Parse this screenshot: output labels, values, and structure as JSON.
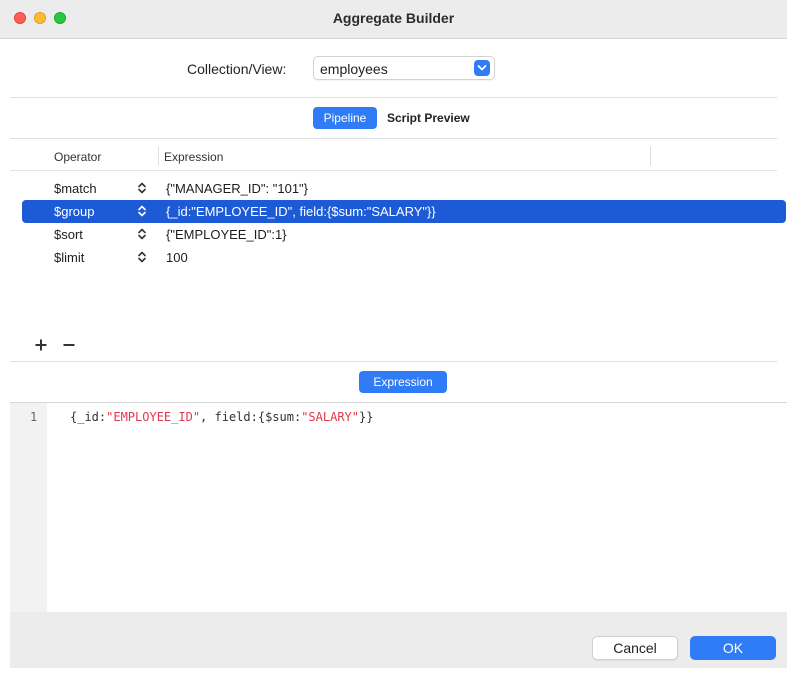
{
  "window": {
    "title": "Aggregate Builder"
  },
  "collection": {
    "label": "Collection/View:",
    "value": "employees"
  },
  "tabs": {
    "pipeline": "Pipeline",
    "script_preview": "Script Preview"
  },
  "table": {
    "columns": {
      "operator": "Operator",
      "expression": "Expression"
    },
    "rows": [
      {
        "operator": "$match",
        "expression": "{\"MANAGER_ID\": \"101\"}",
        "selected": false
      },
      {
        "operator": "$group",
        "expression": "{_id:\"EMPLOYEE_ID\", field:{$sum:\"SALARY\"}}",
        "selected": true
      },
      {
        "operator": "$sort",
        "expression": "{\"EMPLOYEE_ID\":1}",
        "selected": false
      },
      {
        "operator": "$limit",
        "expression": "100",
        "selected": false
      }
    ]
  },
  "toolbar": {
    "add_icon": "plus-icon",
    "remove_icon": "minus-icon"
  },
  "expression_tab": {
    "label": "Expression"
  },
  "editor": {
    "line_number": "1",
    "tokens": [
      {
        "text": "{_id:",
        "kind": "plain"
      },
      {
        "text": "\"EMPLOYEE_ID\"",
        "kind": "string"
      },
      {
        "text": ", field:{$sum:",
        "kind": "plain"
      },
      {
        "text": "\"SALARY\"",
        "kind": "string"
      },
      {
        "text": "}}",
        "kind": "plain"
      }
    ]
  },
  "footer": {
    "cancel_label": "Cancel",
    "ok_label": "OK"
  },
  "colors": {
    "accent": "#2f7cf6",
    "selection": "#1d5bd6",
    "code_string": "#e0384d"
  }
}
